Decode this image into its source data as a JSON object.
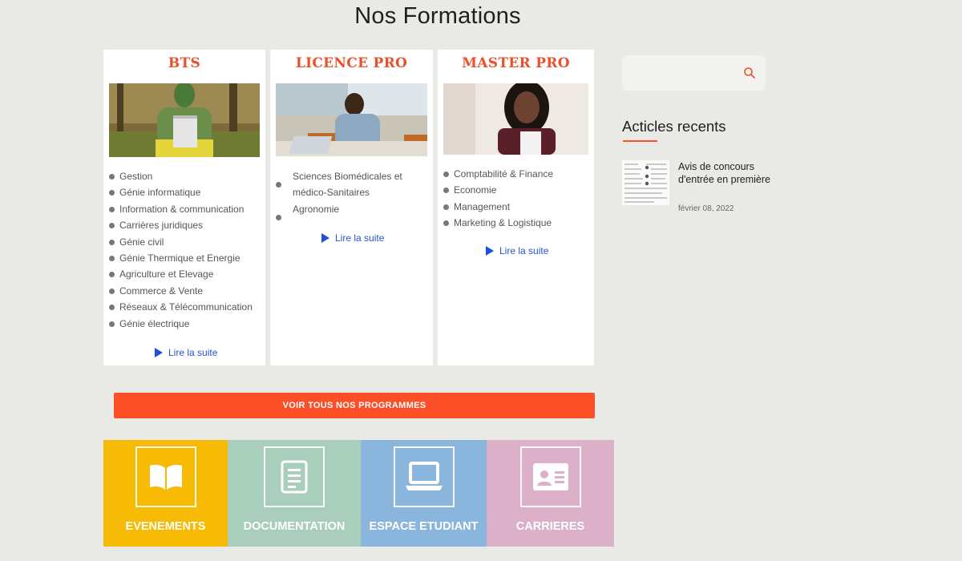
{
  "page": {
    "title": "Nos Formations"
  },
  "cards": [
    {
      "title": "BTS",
      "items": [
        "Gestion",
        "Génie informatique",
        "Information & communication",
        "Carrières juridiques",
        "Génie civil",
        "Génie Thermique et Energie",
        "Agriculture et Elevage",
        "Commerce & Vente",
        "Réseaux & Télécommunication",
        "Génie électrique"
      ],
      "read_more": "Lire la suite"
    },
    {
      "title": "LICENCE PRO",
      "items": [
        "Sciences Biomédicales et médico-Sanitaires",
        "Agronomie"
      ],
      "read_more": "Lire la suite"
    },
    {
      "title": "MASTER PRO",
      "items": [
        "Comptabilité & Finance",
        "Economie",
        "Management",
        "Marketing & Logistique"
      ],
      "read_more": "Lire la suite"
    }
  ],
  "cta": {
    "label": "VOIR TOUS NOS PROGRAMMES",
    "color": "#fb4f27"
  },
  "tiles": [
    {
      "label": "EVENEMENTS",
      "icon": "open-book-icon",
      "color": "#f7ba05"
    },
    {
      "label": "DOCUMENTATION",
      "icon": "document-icon",
      "color": "#a9cebc"
    },
    {
      "label": "ESPACE ETUDIANT",
      "icon": "laptop-icon",
      "color": "#8ab5dc"
    },
    {
      "label": "CARRIERES",
      "icon": "id-card-icon",
      "color": "#dcb0c8"
    }
  ],
  "sidebar": {
    "search": {
      "value": "",
      "placeholder": "",
      "icon": "search-icon"
    },
    "recent_title": "Acticles recents",
    "articles": [
      {
        "title": "Avis de concours d'entrée en première",
        "date": "février 08, 2022"
      }
    ]
  },
  "colors": {
    "accent": "#e9502c",
    "link": "#2157c9",
    "background": "#e9e9e5"
  }
}
